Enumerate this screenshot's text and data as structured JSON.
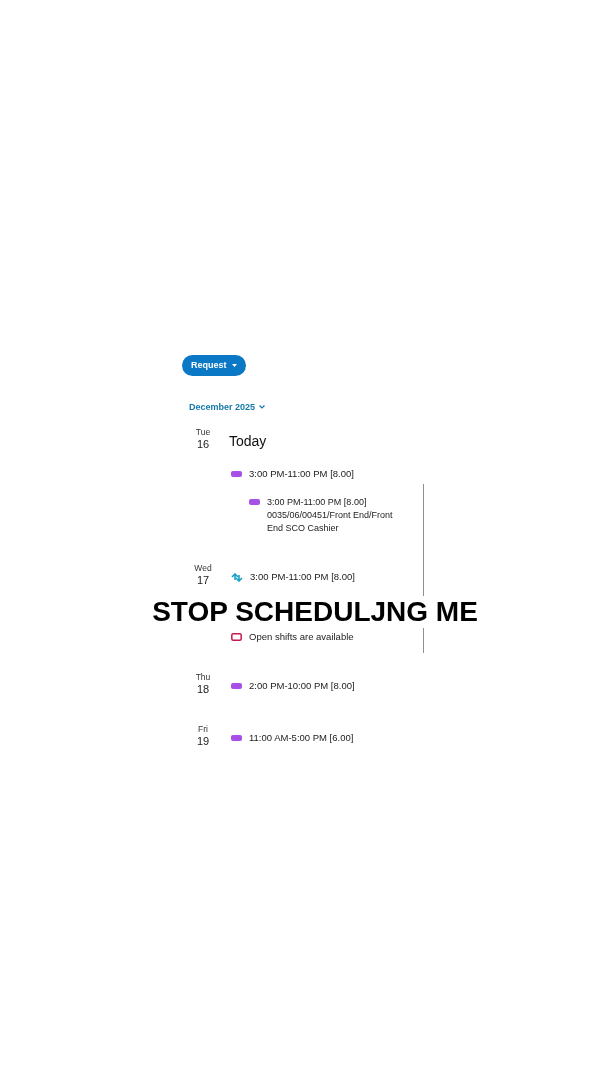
{
  "request_button": {
    "label": "Request"
  },
  "month_picker": {
    "label": "December 2025"
  },
  "days": [
    {
      "weekday": "Tue",
      "date": "16",
      "title": "Today",
      "entries": [
        {
          "kind": "shift",
          "text": "3:00 PM-11:00 PM [8.00]",
          "children": [
            {
              "kind": "shift",
              "text": "3:00 PM-11:00 PM [8.00]",
              "description": "0035/06/00451/Front End/Front End SCO Cashier"
            }
          ]
        }
      ]
    },
    {
      "weekday": "Wed",
      "date": "17",
      "entries": [
        {
          "kind": "swap",
          "text": "3:00 PM-11:00 PM [8.00]"
        },
        {
          "kind": "open_shifts",
          "text": "Open shifts are available"
        }
      ]
    },
    {
      "weekday": "Thu",
      "date": "18",
      "entries": [
        {
          "kind": "shift",
          "text": "2:00 PM-10:00 PM [8.00]"
        }
      ]
    },
    {
      "weekday": "Fri",
      "date": "19",
      "entries": [
        {
          "kind": "shift",
          "text": "11:00 AM-5:00 PM [6.00]"
        }
      ]
    }
  ],
  "caption": "STOP SCHEDULJNG ME"
}
